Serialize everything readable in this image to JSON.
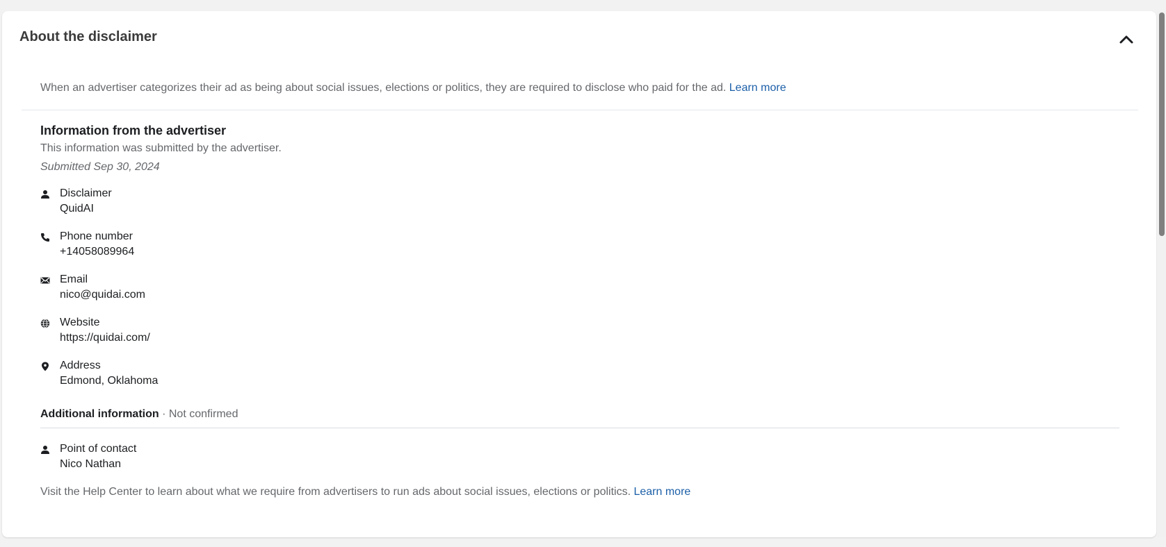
{
  "header": {
    "title": "About the disclaimer"
  },
  "intro": {
    "text": "When an advertiser categorizes their ad as being about social issues, elections or politics, they are required to disclose who paid for the ad. ",
    "link_label": "Learn more"
  },
  "advertiser": {
    "title": "Information from the advertiser",
    "subtitle": "This information was submitted by the advertiser.",
    "submitted": "Submitted Sep 30, 2024",
    "fields": [
      {
        "icon": "person-icon",
        "label": "Disclaimer",
        "value": "QuidAI"
      },
      {
        "icon": "phone-icon",
        "label": "Phone number",
        "value": "+14058089964"
      },
      {
        "icon": "envelope-icon",
        "label": "Email",
        "value": "nico@quidai.com"
      },
      {
        "icon": "globe-icon",
        "label": "Website",
        "value": "https://quidai.com/"
      },
      {
        "icon": "location-pin-icon",
        "label": "Address",
        "value": "Edmond, Oklahoma"
      }
    ]
  },
  "additional": {
    "title": "Additional information",
    "separator": " · ",
    "status": "Not confirmed",
    "fields": [
      {
        "icon": "person-icon",
        "label": "Point of contact",
        "value": "Nico Nathan"
      }
    ]
  },
  "footer": {
    "text": "Visit the Help Center to learn about what we require from advertisers to run ads about social issues, elections or politics. ",
    "link_label": "Learn more"
  },
  "colors": {
    "link": "#1c5fa8",
    "muted_text": "#65676b",
    "primary_text": "#1c1e21",
    "background": "#f2f2f2"
  }
}
